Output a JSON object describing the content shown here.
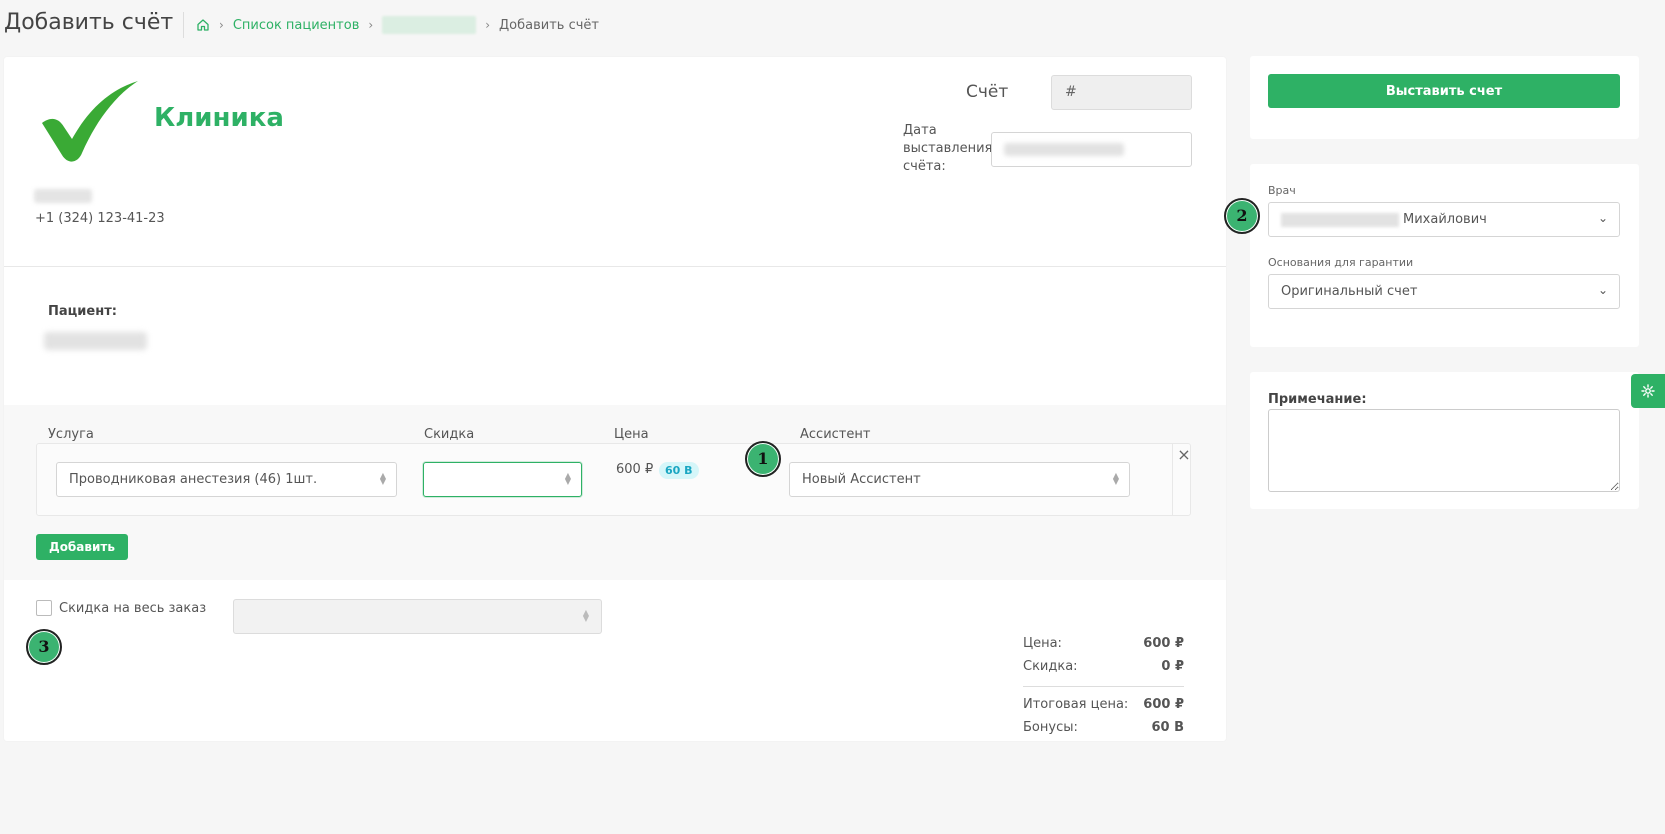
{
  "header": {
    "title": "Добавить счёт",
    "breadcrumb": {
      "patients_list": "Список пациентов",
      "current": "Добавить счёт"
    }
  },
  "clinic": {
    "name": "Клиника",
    "phone": "+1 (324) 123-41-23",
    "brand_color": "#2eb165"
  },
  "invoice": {
    "label": "Счёт",
    "number_placeholder": "#",
    "date_label": "Дата выставления счёта:"
  },
  "patient": {
    "label": "Пациент:"
  },
  "services": {
    "headers": {
      "service": "Услуга",
      "discount": "Скидка",
      "price": "Цена",
      "assistant": "Ассистент"
    },
    "rows": [
      {
        "service": "Проводниковая анестезия (46) 1шт.",
        "discount": "",
        "price": "600 ₽",
        "bonus": "60 B",
        "assistant": "Новый Ассистент"
      }
    ],
    "add_label": "Добавить"
  },
  "order_discount": {
    "label": "Скидка на весь заказ"
  },
  "summary": {
    "price_label": "Цена:",
    "price_value": "600 ₽",
    "discount_label": "Скидка:",
    "discount_value": "0 ₽",
    "total_label": "Итоговая цена:",
    "total_value": "600 ₽",
    "bonus_label": "Бонусы:",
    "bonus_value": "60 B"
  },
  "sidebar": {
    "issue_button": "Выставить счет",
    "doctor_label": "Врач",
    "doctor_value_suffix": "Михайлович",
    "guarantee_label": "Основания для гарантии",
    "guarantee_value": "Оригинальный счет",
    "note_label": "Примечание:"
  },
  "markers": [
    "1",
    "2",
    "3"
  ]
}
